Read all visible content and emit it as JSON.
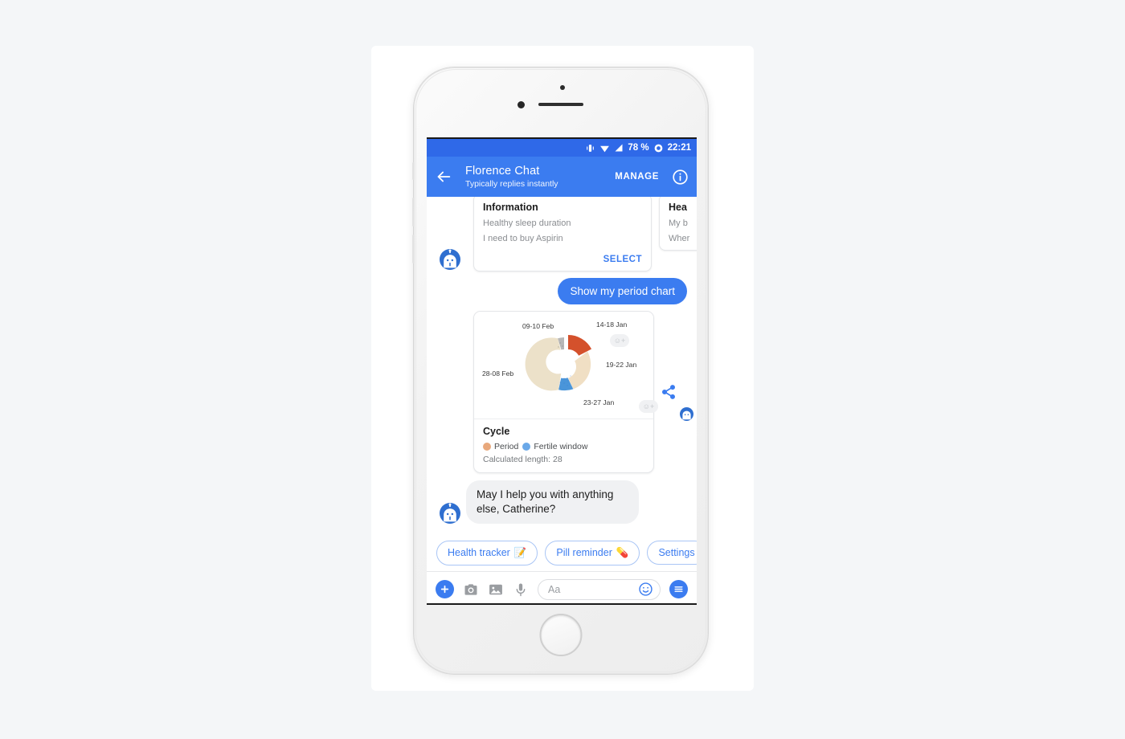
{
  "status_bar": {
    "battery": "78 %",
    "time": "22:21",
    "icons": [
      "vibrate-icon",
      "wifi-icon",
      "signal-icon",
      "alarm-icon"
    ]
  },
  "nav_bar": {
    "back_icon": "back-arrow-icon",
    "title": "Florence Chat",
    "subtitle": "Typically replies instantly",
    "manage_label": "MANAGE",
    "info_icon": "info-circle-icon"
  },
  "cards": [
    {
      "title": "Information",
      "lines": [
        "Healthy sleep duration",
        "I need to buy Aspirin"
      ],
      "action": "SELECT"
    },
    {
      "title": "Hea",
      "lines": [
        "My b",
        "Wher"
      ],
      "action": ""
    }
  ],
  "user_message": {
    "text": "Show my period chart"
  },
  "chart_card": {
    "cycle_title": "Cycle",
    "legend": [
      {
        "label": "Period",
        "color": "#e8a87c"
      },
      {
        "label": "Fertile window",
        "color": "#6aa8e8"
      }
    ],
    "calculated_length": "Calculated length: 28",
    "share_icon": "share-icon",
    "reaction_icon": "add-reaction-icon"
  },
  "chart_data": {
    "type": "pie",
    "title": "Cycle",
    "subtitle": "Calculated length: 28",
    "donut": true,
    "exploded_slice": "14-18 Jan",
    "categories": [
      "14-18 Jan",
      "19-22 Jan",
      "23-27 Jan",
      "28-08 Feb",
      "09-10 Feb"
    ],
    "values": [
      5,
      4,
      5,
      12,
      2
    ],
    "labels": [
      "14-18 Jan",
      "19-22 Jan",
      "23-27 Jan",
      "28-08 Feb",
      "09-10 Feb"
    ],
    "colors": [
      "#d4512c",
      "#f0dfc4",
      "#4a95d9",
      "#ece1c9",
      "#b7b7b7"
    ],
    "legend_entries": [
      "Period",
      "Fertile window"
    ],
    "legend_position": "bottom-left",
    "grid": false,
    "cycle_length": 28
  },
  "bot_message": {
    "text": "May I help you with anything else, Catherine?",
    "reaction_icon": "add-reaction-icon"
  },
  "quick_replies": [
    {
      "label": "Health tracker",
      "emoji": "📝"
    },
    {
      "label": "Pill reminder",
      "emoji": "💊"
    },
    {
      "label": "Settings",
      "emoji": ""
    }
  ],
  "composer": {
    "plus_icon": "plus-icon",
    "camera_icon": "camera-icon",
    "gallery_icon": "image-icon",
    "mic_icon": "microphone-icon",
    "placeholder": "Aa",
    "emoji_icon": "emoji-smiley-icon",
    "menu_icon": "hamburger-menu-icon"
  },
  "theme": {
    "accent": "#3b7cf0",
    "status_bar": "#2f69e8",
    "page_bg": "#f4f6f8"
  }
}
